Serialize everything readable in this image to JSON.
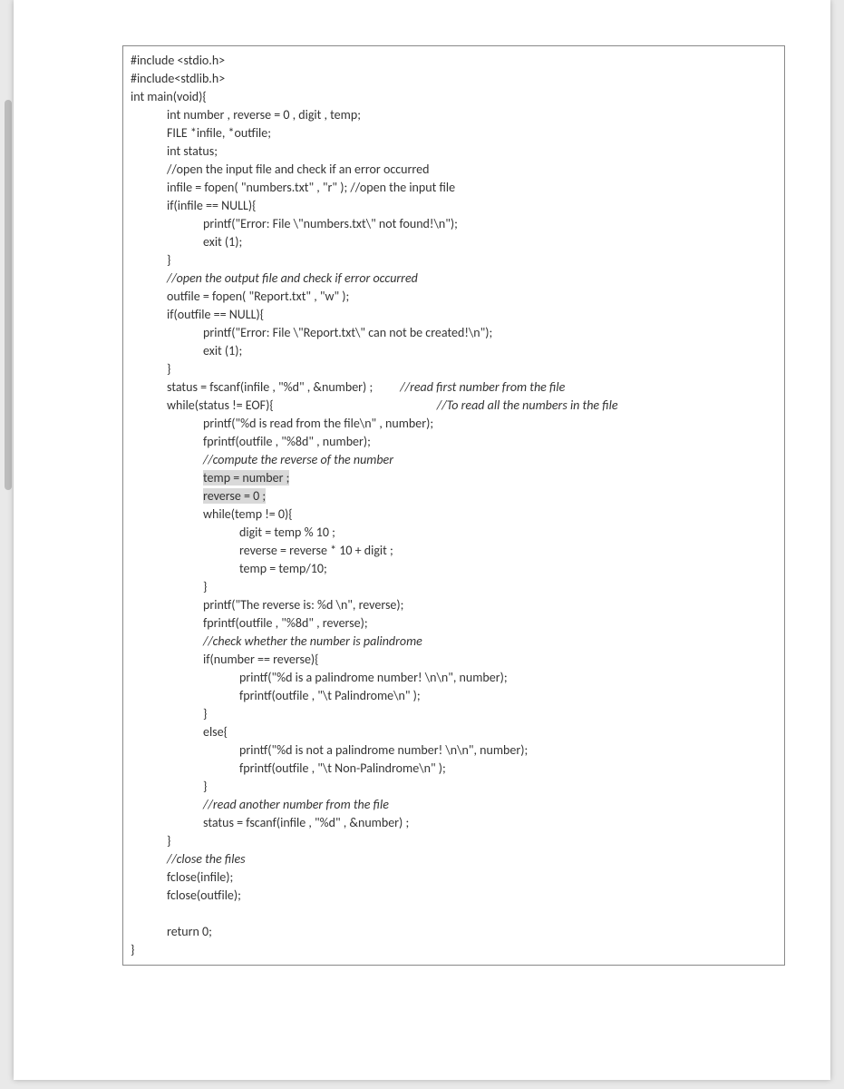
{
  "code": {
    "l01": "#include <stdio.h>",
    "l02": "#include<stdlib.h>",
    "l03": "int main(void){",
    "l04": "int number , reverse = 0 , digit , temp;",
    "l05": "FILE *infile, *outfile;",
    "l06": "int status;",
    "l07": "//open the input file and check if an error occurred",
    "l08": "infile = fopen( \"numbers.txt\" , \"r\" ); //open the input file",
    "l09": "if(infile == NULL){",
    "l10": "printf(\"Error: File \\\"numbers.txt\\\" not found!\\n\");",
    "l11": "exit (1);",
    "l12": "}",
    "l13": "//open the output file and check if error occurred",
    "l14": "outfile = fopen( \"Report.txt\" , \"w\" );",
    "l15": "if(outfile == NULL){",
    "l16": "printf(\"Error: File \\\"Report.txt\\\" can not be created!\\n\");",
    "l17": "exit (1);",
    "l18": "}",
    "l19a": "status = fscanf(infile , \"%d\" , &number) ;",
    "l19b": "//read first number from the file",
    "l20a": "while(status != EOF){",
    "l20b": "//To read all the numbers in the file",
    "l21": "printf(\"%d is read from the file\\n\" , number);",
    "l22": "fprintf(outfile , \"%8d\" , number);",
    "l23": "//compute the reverse of the number",
    "l24": "temp = number ;",
    "l25": "reverse = 0 ;",
    "l26": "while(temp != 0){",
    "l27": "digit = temp % 10 ;",
    "l28": "reverse = reverse * 10 + digit ;",
    "l29": "temp = temp/10;",
    "l30": "}",
    "l31": "printf(\"The reverse is: %d \\n\", reverse);",
    "l32": "fprintf(outfile , \"%8d\" , reverse);",
    "l33": "//check whether the number is palindrome",
    "l34": "if(number == reverse){",
    "l35": "printf(\"%d is a palindrome number! \\n\\n\", number);",
    "l36": "fprintf(outfile , \"\\t Palindrome\\n\" );",
    "l37": "}",
    "l38": "else{",
    "l39": "printf(\"%d is not a palindrome number! \\n\\n\", number);",
    "l40": "fprintf(outfile , \"\\t Non-Palindrome\\n\" );",
    "l41": "}",
    "l42": "//read another number from the file",
    "l43": "status = fscanf(infile , \"%d\" , &number) ;",
    "l44": "}",
    "l45": "//close the files",
    "l46": "fclose(infile);",
    "l47": "fclose(outfile);",
    "blank": " ",
    "l48": "return 0;",
    "l49": "}"
  }
}
